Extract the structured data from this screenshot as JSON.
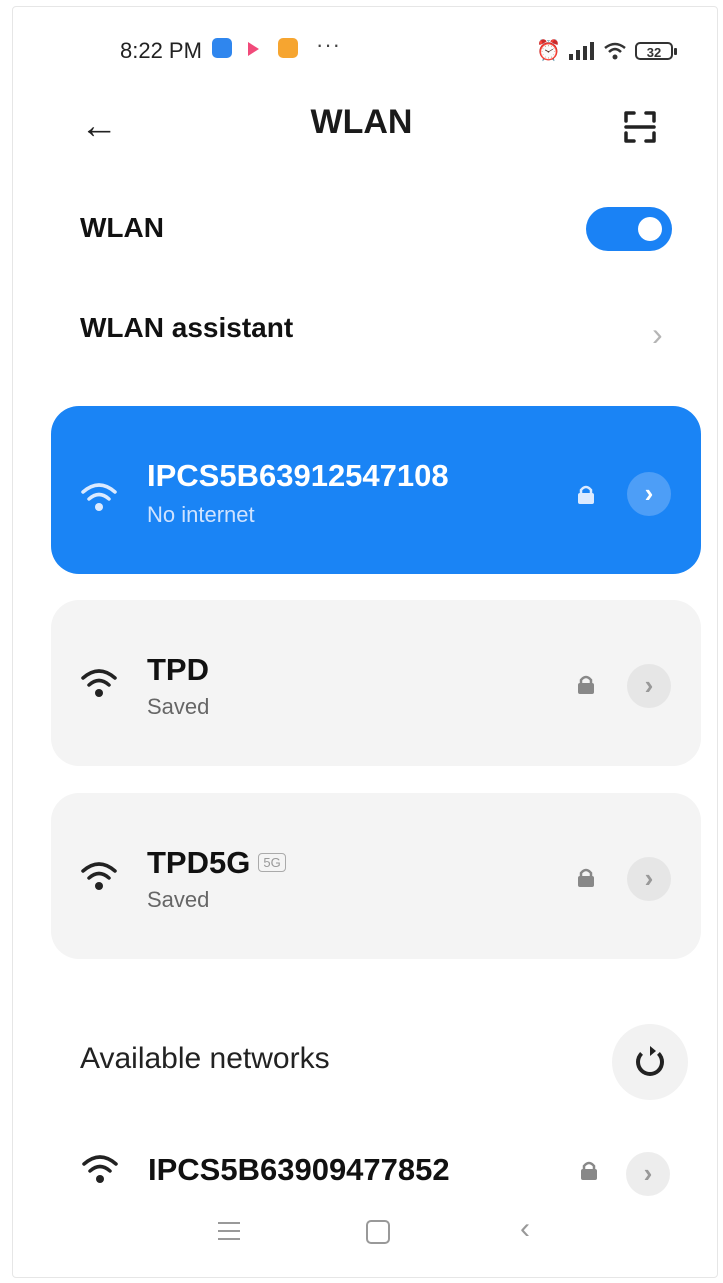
{
  "status_bar": {
    "time": "8:22 PM",
    "more": "···",
    "battery": "32"
  },
  "header": {
    "back_icon": "←",
    "title": "WLAN"
  },
  "wlan_toggle": {
    "label": "WLAN",
    "state": "on"
  },
  "wlan_assistant": {
    "label": "WLAN assistant",
    "chevron": "›"
  },
  "connected": {
    "ssid": "IPCS5B63912547108",
    "status": "No internet",
    "go": "›"
  },
  "saved_networks": [
    {
      "ssid": "TPD",
      "status": "Saved",
      "badge": "",
      "go": "›"
    },
    {
      "ssid": "TPD5G",
      "status": "Saved",
      "badge": "5G",
      "go": "›"
    }
  ],
  "available": {
    "label": "Available networks",
    "networks": [
      {
        "ssid": "IPCS5B63909477852",
        "go": "›"
      }
    ]
  },
  "nav": {
    "back": "‹"
  },
  "colors": {
    "accent": "#1a84f5",
    "card_bg": "#f4f4f4",
    "muted": "#999999"
  }
}
